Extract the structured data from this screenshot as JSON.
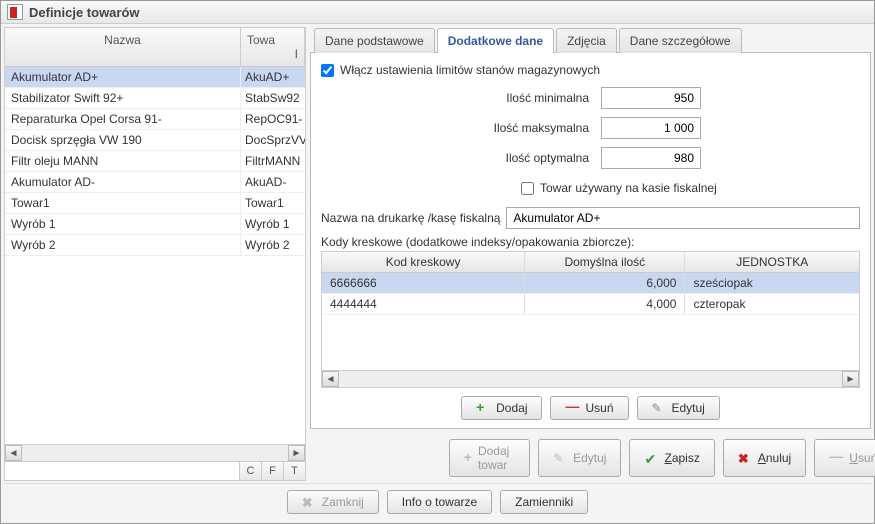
{
  "window": {
    "title": "Definicje towarów"
  },
  "grid": {
    "headers": {
      "name": "Nazwa",
      "code_top": "Towa",
      "code_sub": "I"
    },
    "rows": [
      {
        "name": "Akumulator AD+",
        "code": "AkuAD+",
        "selected": true
      },
      {
        "name": "Stabilizator Swift 92+",
        "code": "StabSw92"
      },
      {
        "name": "Reparaturka Opel Corsa 91-",
        "code": "RepOC91-"
      },
      {
        "name": "Docisk sprzęgła VW 190",
        "code": "DocSprzVV"
      },
      {
        "name": "Filtr oleju MANN",
        "code": "FiltrMANN"
      },
      {
        "name": "Akumulator AD-",
        "code": "AkuAD-"
      },
      {
        "name": "Towar1",
        "code": "Towar1"
      },
      {
        "name": "Wyrób 1",
        "code": "Wyrób 1"
      },
      {
        "name": "Wyrób 2",
        "code": "Wyrób 2"
      }
    ],
    "footer_tabs": [
      "C",
      "F",
      "T"
    ]
  },
  "tabs": {
    "basic": "Dane podstawowe",
    "extra": "Dodatkowe dane",
    "photos": "Zdjęcia",
    "detail": "Dane szczegółowe"
  },
  "extra": {
    "enable_limits": "Włącz ustawienia limitów stanów magazynowych",
    "min_label": "Ilość minimalna",
    "min_val": "950",
    "max_label": "Ilość maksymalna",
    "max_val": "1 000",
    "opt_label": "Ilość optymalna",
    "opt_val": "980",
    "fiscal_chk": "Towar używany na kasie fiskalnej",
    "printer_label": "Nazwa na drukarkę /kasę fiskalną",
    "printer_val": "Akumulator AD+",
    "barcode_heading": "Kody kreskowe (dodatkowe indeksy/opakowania zbiorcze):",
    "bc_headers": {
      "code": "Kod kreskowy",
      "qty": "Domyślna ilość",
      "unit": "JEDNOSTKA"
    },
    "bc_rows": [
      {
        "code": "6666666",
        "qty": "6,000",
        "unit": "sześciopak",
        "selected": true
      },
      {
        "code": "4444444",
        "qty": "4,000",
        "unit": "czteropak"
      }
    ]
  },
  "buttons": {
    "add": "Dodaj",
    "remove": "Usuń",
    "edit": "Edytuj",
    "add_item": "Dodaj towar",
    "edit2": "Edytuj",
    "save": "Zapisz",
    "cancel": "Anuluj",
    "delete": "Usuń",
    "close": "Zamknij",
    "info": "Info o towarze",
    "subst": "Zamienniki"
  }
}
